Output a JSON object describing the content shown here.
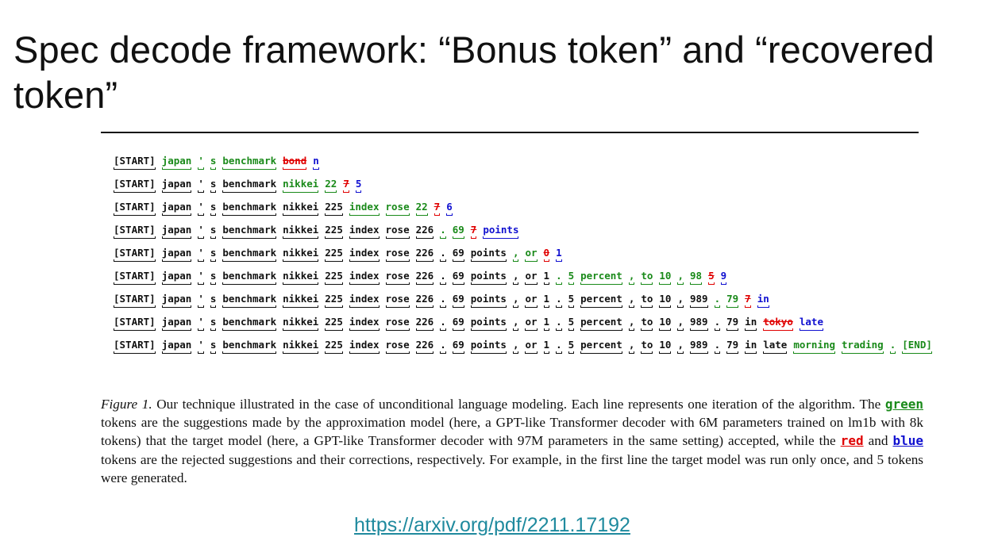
{
  "slide": {
    "title": "Spec decode framework: “Bonus token” and “recovered token”"
  },
  "figure": {
    "token_lines": [
      [
        {
          "t": "[START]",
          "c": "plain"
        },
        {
          "t": "japan",
          "c": "green"
        },
        {
          "t": "'",
          "c": "green"
        },
        {
          "t": "s",
          "c": "green"
        },
        {
          "t": "benchmark",
          "c": "green"
        },
        {
          "t": "bond",
          "c": "red"
        },
        {
          "t": "n",
          "c": "blue"
        }
      ],
      [
        {
          "t": "[START]",
          "c": "plain"
        },
        {
          "t": "japan",
          "c": "plain"
        },
        {
          "t": "'",
          "c": "plain"
        },
        {
          "t": "s",
          "c": "plain"
        },
        {
          "t": "benchmark",
          "c": "plain"
        },
        {
          "t": "nikkei",
          "c": "green"
        },
        {
          "t": "22",
          "c": "green"
        },
        {
          "t": "7",
          "c": "red"
        },
        {
          "t": "5",
          "c": "blue"
        }
      ],
      [
        {
          "t": "[START]",
          "c": "plain"
        },
        {
          "t": "japan",
          "c": "plain"
        },
        {
          "t": "'",
          "c": "plain"
        },
        {
          "t": "s",
          "c": "plain"
        },
        {
          "t": "benchmark",
          "c": "plain"
        },
        {
          "t": "nikkei",
          "c": "plain"
        },
        {
          "t": "225",
          "c": "plain"
        },
        {
          "t": "index",
          "c": "green"
        },
        {
          "t": "rose",
          "c": "green"
        },
        {
          "t": "22",
          "c": "green"
        },
        {
          "t": "7",
          "c": "red"
        },
        {
          "t": "6",
          "c": "blue"
        }
      ],
      [
        {
          "t": "[START]",
          "c": "plain"
        },
        {
          "t": "japan",
          "c": "plain"
        },
        {
          "t": "'",
          "c": "plain"
        },
        {
          "t": "s",
          "c": "plain"
        },
        {
          "t": "benchmark",
          "c": "plain"
        },
        {
          "t": "nikkei",
          "c": "plain"
        },
        {
          "t": "225",
          "c": "plain"
        },
        {
          "t": "index",
          "c": "plain"
        },
        {
          "t": "rose",
          "c": "plain"
        },
        {
          "t": "226",
          "c": "plain"
        },
        {
          "t": ".",
          "c": "green"
        },
        {
          "t": "69",
          "c": "green"
        },
        {
          "t": "7",
          "c": "red"
        },
        {
          "t": "points",
          "c": "blue"
        }
      ],
      [
        {
          "t": "[START]",
          "c": "plain"
        },
        {
          "t": "japan",
          "c": "plain"
        },
        {
          "t": "'",
          "c": "plain"
        },
        {
          "t": "s",
          "c": "plain"
        },
        {
          "t": "benchmark",
          "c": "plain"
        },
        {
          "t": "nikkei",
          "c": "plain"
        },
        {
          "t": "225",
          "c": "plain"
        },
        {
          "t": "index",
          "c": "plain"
        },
        {
          "t": "rose",
          "c": "plain"
        },
        {
          "t": "226",
          "c": "plain"
        },
        {
          "t": ".",
          "c": "plain"
        },
        {
          "t": "69",
          "c": "plain"
        },
        {
          "t": "points",
          "c": "plain"
        },
        {
          "t": ",",
          "c": "green"
        },
        {
          "t": "or",
          "c": "green"
        },
        {
          "t": "0",
          "c": "red"
        },
        {
          "t": "1",
          "c": "blue"
        }
      ],
      [
        {
          "t": "[START]",
          "c": "plain"
        },
        {
          "t": "japan",
          "c": "plain"
        },
        {
          "t": "'",
          "c": "plain"
        },
        {
          "t": "s",
          "c": "plain"
        },
        {
          "t": "benchmark",
          "c": "plain"
        },
        {
          "t": "nikkei",
          "c": "plain"
        },
        {
          "t": "225",
          "c": "plain"
        },
        {
          "t": "index",
          "c": "plain"
        },
        {
          "t": "rose",
          "c": "plain"
        },
        {
          "t": "226",
          "c": "plain"
        },
        {
          "t": ".",
          "c": "plain"
        },
        {
          "t": "69",
          "c": "plain"
        },
        {
          "t": "points",
          "c": "plain"
        },
        {
          "t": ",",
          "c": "plain"
        },
        {
          "t": "or",
          "c": "plain"
        },
        {
          "t": "1",
          "c": "plain"
        },
        {
          "t": ".",
          "c": "green"
        },
        {
          "t": "5",
          "c": "green"
        },
        {
          "t": "percent",
          "c": "green"
        },
        {
          "t": ",",
          "c": "green"
        },
        {
          "t": "to",
          "c": "green"
        },
        {
          "t": "10",
          "c": "green"
        },
        {
          "t": ",",
          "c": "green"
        },
        {
          "t": "98",
          "c": "green"
        },
        {
          "t": "5",
          "c": "red"
        },
        {
          "t": "9",
          "c": "blue"
        }
      ],
      [
        {
          "t": "[START]",
          "c": "plain"
        },
        {
          "t": "japan",
          "c": "plain"
        },
        {
          "t": "'",
          "c": "plain"
        },
        {
          "t": "s",
          "c": "plain"
        },
        {
          "t": "benchmark",
          "c": "plain"
        },
        {
          "t": "nikkei",
          "c": "plain"
        },
        {
          "t": "225",
          "c": "plain"
        },
        {
          "t": "index",
          "c": "plain"
        },
        {
          "t": "rose",
          "c": "plain"
        },
        {
          "t": "226",
          "c": "plain"
        },
        {
          "t": ".",
          "c": "plain"
        },
        {
          "t": "69",
          "c": "plain"
        },
        {
          "t": "points",
          "c": "plain"
        },
        {
          "t": ",",
          "c": "plain"
        },
        {
          "t": "or",
          "c": "plain"
        },
        {
          "t": "1",
          "c": "plain"
        },
        {
          "t": ".",
          "c": "plain"
        },
        {
          "t": "5",
          "c": "plain"
        },
        {
          "t": "percent",
          "c": "plain"
        },
        {
          "t": ",",
          "c": "plain"
        },
        {
          "t": "to",
          "c": "plain"
        },
        {
          "t": "10",
          "c": "plain"
        },
        {
          "t": ",",
          "c": "plain"
        },
        {
          "t": "989",
          "c": "plain"
        },
        {
          "t": ".",
          "c": "green"
        },
        {
          "t": "79",
          "c": "green"
        },
        {
          "t": "7",
          "c": "red"
        },
        {
          "t": "in",
          "c": "blue"
        }
      ],
      [
        {
          "t": "[START]",
          "c": "plain"
        },
        {
          "t": "japan",
          "c": "plain"
        },
        {
          "t": "'",
          "c": "plain"
        },
        {
          "t": "s",
          "c": "plain"
        },
        {
          "t": "benchmark",
          "c": "plain"
        },
        {
          "t": "nikkei",
          "c": "plain"
        },
        {
          "t": "225",
          "c": "plain"
        },
        {
          "t": "index",
          "c": "plain"
        },
        {
          "t": "rose",
          "c": "plain"
        },
        {
          "t": "226",
          "c": "plain"
        },
        {
          "t": ".",
          "c": "plain"
        },
        {
          "t": "69",
          "c": "plain"
        },
        {
          "t": "points",
          "c": "plain"
        },
        {
          "t": ",",
          "c": "plain"
        },
        {
          "t": "or",
          "c": "plain"
        },
        {
          "t": "1",
          "c": "plain"
        },
        {
          "t": ".",
          "c": "plain"
        },
        {
          "t": "5",
          "c": "plain"
        },
        {
          "t": "percent",
          "c": "plain"
        },
        {
          "t": ",",
          "c": "plain"
        },
        {
          "t": "to",
          "c": "plain"
        },
        {
          "t": "10",
          "c": "plain"
        },
        {
          "t": ",",
          "c": "plain"
        },
        {
          "t": "989",
          "c": "plain"
        },
        {
          "t": ".",
          "c": "plain"
        },
        {
          "t": "79",
          "c": "plain"
        },
        {
          "t": "in",
          "c": "plain"
        },
        {
          "t": "tokyo",
          "c": "red"
        },
        {
          "t": "late",
          "c": "blue"
        }
      ],
      [
        {
          "t": "[START]",
          "c": "plain"
        },
        {
          "t": "japan",
          "c": "plain"
        },
        {
          "t": "'",
          "c": "plain"
        },
        {
          "t": "s",
          "c": "plain"
        },
        {
          "t": "benchmark",
          "c": "plain"
        },
        {
          "t": "nikkei",
          "c": "plain"
        },
        {
          "t": "225",
          "c": "plain"
        },
        {
          "t": "index",
          "c": "plain"
        },
        {
          "t": "rose",
          "c": "plain"
        },
        {
          "t": "226",
          "c": "plain"
        },
        {
          "t": ".",
          "c": "plain"
        },
        {
          "t": "69",
          "c": "plain"
        },
        {
          "t": "points",
          "c": "plain"
        },
        {
          "t": ",",
          "c": "plain"
        },
        {
          "t": "or",
          "c": "plain"
        },
        {
          "t": "1",
          "c": "plain"
        },
        {
          "t": ".",
          "c": "plain"
        },
        {
          "t": "5",
          "c": "plain"
        },
        {
          "t": "percent",
          "c": "plain"
        },
        {
          "t": ",",
          "c": "plain"
        },
        {
          "t": "to",
          "c": "plain"
        },
        {
          "t": "10",
          "c": "plain"
        },
        {
          "t": ",",
          "c": "plain"
        },
        {
          "t": "989",
          "c": "plain"
        },
        {
          "t": ".",
          "c": "plain"
        },
        {
          "t": "79",
          "c": "plain"
        },
        {
          "t": "in",
          "c": "plain"
        },
        {
          "t": "late",
          "c": "plain"
        },
        {
          "t": "morning",
          "c": "green"
        },
        {
          "t": "trading",
          "c": "green"
        },
        {
          "t": ".",
          "c": "green"
        },
        {
          "t": "[END]",
          "c": "green"
        }
      ]
    ],
    "caption": {
      "label": "Figure 1.",
      "part1": " Our technique illustrated in the case of unconditional language modeling. Each line represents one iteration of the algorithm. The ",
      "kw_green": "green",
      "part2": " tokens are the suggestions made by the approximation model (here, a GPT-like Transformer decoder with 6M parameters trained on lm1b with 8k tokens) that the target model (here, a GPT-like Transformer decoder with 97M parameters in the same setting) accepted, while the ",
      "kw_red": "red",
      "part3": " and ",
      "kw_blue": "blue",
      "part4": " tokens are the rejected suggestions and their corrections, respectively. For example, in the first line the target model was run only once, and 5 tokens were generated."
    }
  },
  "source": {
    "link_text": "https://arxiv.org/pdf/2211.17192"
  },
  "colors": {
    "accepted": "#1a8a1a",
    "rejected": "#e00000",
    "correction": "#1010d0",
    "link": "#1f8a9e"
  }
}
